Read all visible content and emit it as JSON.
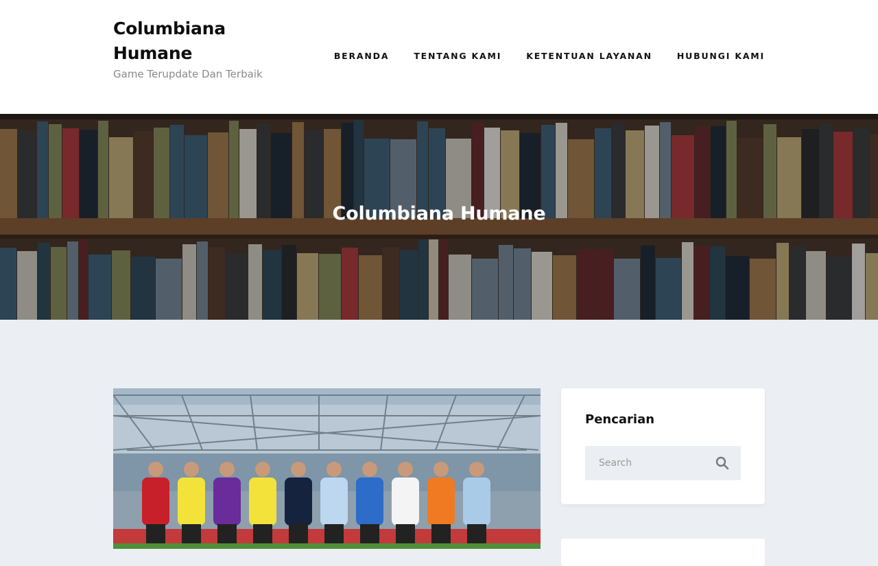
{
  "header": {
    "site_title": "Columbiana Humane",
    "tagline": "Game Terupdate Dan Terbaik",
    "nav": [
      {
        "label": "BERANDA"
      },
      {
        "label": "TENTANG KAMI"
      },
      {
        "label": "KETENTUAN LAYANAN"
      },
      {
        "label": "HUBUNGI KAMI"
      }
    ]
  },
  "hero": {
    "title": "Columbiana Humane"
  },
  "sidebar": {
    "search_widget": {
      "title": "Pencarian",
      "placeholder": "Search",
      "icon": "search-icon"
    }
  },
  "colors": {
    "page_background": "#ebeef2",
    "header_background": "#ffffff",
    "text_primary": "#111111",
    "tagline": "#8a8a8a"
  }
}
